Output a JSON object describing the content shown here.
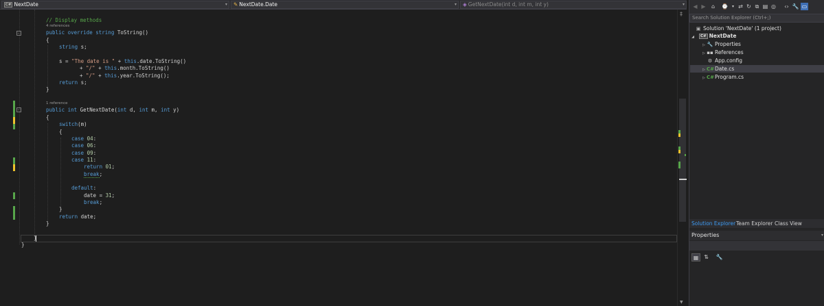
{
  "navbar": {
    "project_badge": "C#",
    "project": "NextDate",
    "type": "NextDate.Date",
    "member": "GetNextDate(int d, int m, int y)"
  },
  "code": {
    "comment_display": "// Display methods",
    "refs_tostring": "4 references",
    "public_1": "public",
    "override": "override",
    "string_kw": "string",
    "tostring_name": "ToString()",
    "brace_open": "{",
    "brace_close": "}",
    "string_decl_kw": "string",
    "string_decl_rest": "s;",
    "assign_lhs": "s = ",
    "assign_str": "\"The date is \"",
    "assign_plus": " + ",
    "this_kw": "this",
    "assign_rest": ".date.ToString()",
    "concat_plus": "+ ",
    "slash_str": "\"/\"",
    "month_rest": ".month.ToString()",
    "year_rest": ".year.ToString();",
    "return_kw": "return",
    "return_s": "s;",
    "refs_getnext": "1 reference",
    "public_2": "public",
    "int_kw": "int",
    "method_name": "GetNextDate(",
    "param_d": "d, ",
    "param_m": "m, ",
    "param_y": "y)",
    "switch_kw": "switch",
    "switch_arg": "(m)",
    "case_kw": "case",
    "case_04": "04",
    "case_06": "06",
    "case_09": "09",
    "case_11": "11",
    "colon": ":",
    "return_01_val": "01",
    "semicolon": ";",
    "break_kw": "break",
    "default_kw": "default",
    "date_assign": "date = ",
    "date_val": "31",
    "return_date": "date;",
    "class_close": "}",
    "ns_close": "}"
  },
  "solution_explorer": {
    "search_placeholder": "Search Solution Explorer (Ctrl+;)",
    "solution": "Solution 'NextDate' (1 project)",
    "project_badge": "C#",
    "project": "NextDate",
    "items": [
      "Properties",
      "References",
      "App.config",
      "Date.cs",
      "Program.cs"
    ],
    "selected": "Date.cs",
    "tabs": [
      "Solution Explorer",
      "Team Explorer",
      "Class View"
    ],
    "active_tab": "Solution Explorer"
  },
  "properties": {
    "title": "Properties"
  },
  "colors": {
    "background": "#1e1e1e",
    "keyword": "#569cd6",
    "string": "#d69d85",
    "comment": "#57a64a",
    "number": "#b5cea8",
    "active_tab": "#3d9bf3",
    "change_saved": "#57a64a",
    "change_unsaved": "#eec32c"
  }
}
